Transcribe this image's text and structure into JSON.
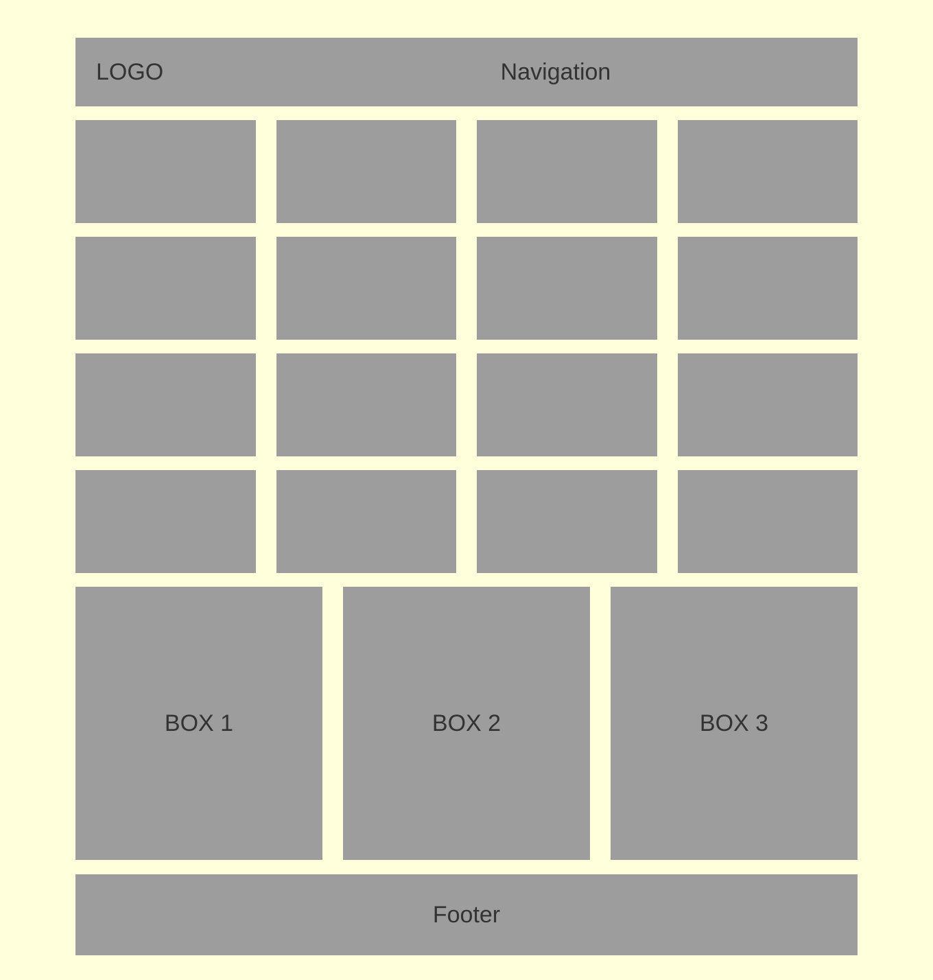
{
  "header": {
    "logo": "LOGO",
    "navigation": "Navigation"
  },
  "grid_cell_count": 16,
  "boxes": [
    {
      "label": "BOX 1"
    },
    {
      "label": "BOX 2"
    },
    {
      "label": "BOX 3"
    }
  ],
  "footer": {
    "label": "Footer"
  },
  "colors": {
    "background": "#ffffdc",
    "block": "#9d9d9d",
    "text": "#333333"
  }
}
